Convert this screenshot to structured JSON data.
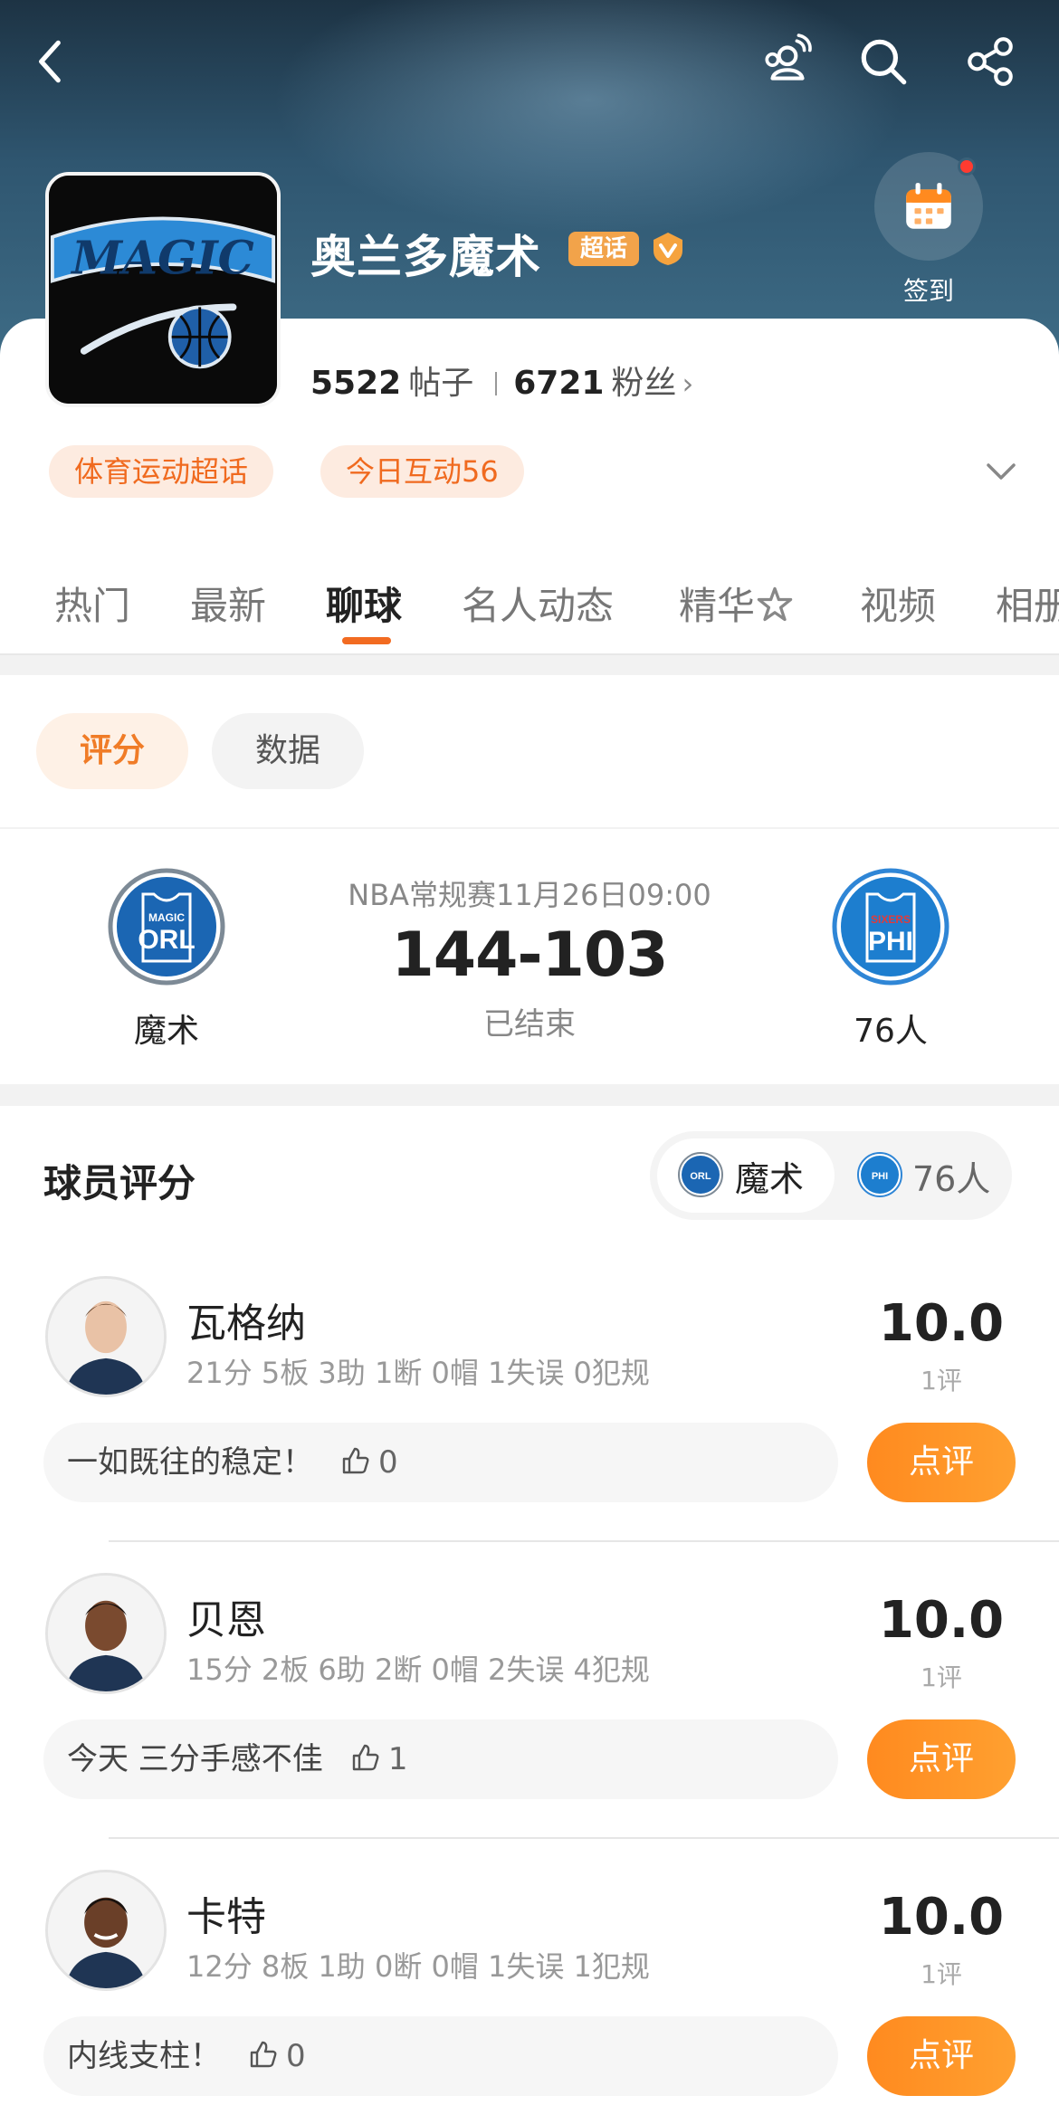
{
  "header": {
    "team_name": "奥兰多魔术",
    "super_badge": "超话",
    "signin_label": "签到"
  },
  "stats": {
    "posts_count": "5522",
    "posts_label": "帖子",
    "fans_count": "6721",
    "fans_label": "粉丝"
  },
  "tags": [
    "体育运动超话",
    "今日互动56"
  ],
  "tabs": [
    "热门",
    "最新",
    "聊球",
    "名人动态",
    "精华",
    "视频",
    "相册"
  ],
  "active_tab": "聊球",
  "segment": {
    "rating": "评分",
    "data": "数据"
  },
  "match": {
    "meta": "NBA常规赛11月26日09:00",
    "score": "144-103",
    "status": "已结束",
    "home_team": "魔术",
    "away_team": "76人",
    "home_logo_text": "MAGIC",
    "home_abbr": "ORL",
    "away_logo_text": "SIXERS",
    "away_abbr": "PHI"
  },
  "ratings": {
    "title": "球员评分",
    "switch_home": "魔术",
    "switch_away": "76人",
    "review_label": "点评",
    "players": [
      {
        "name": "瓦格纳",
        "stats": "21分 5板 3助 1断 0帽 1失误 0犯规",
        "score": "10.0",
        "count": "1评",
        "comment": "一如既往的稳定！",
        "likes": "0"
      },
      {
        "name": "贝恩",
        "stats": "15分 2板 6助 2断 0帽 2失误 4犯规",
        "score": "10.0",
        "count": "1评",
        "comment": "今天 三分手感不佳",
        "likes": "1"
      },
      {
        "name": "卡特",
        "stats": "12分 8板 1助 0断 0帽 1失误 1犯规",
        "score": "10.0",
        "count": "1评",
        "comment": "内线支柱！",
        "likes": "0"
      }
    ]
  },
  "colors": {
    "accent": "#f26b21",
    "button": "#ff8a1f",
    "magic_blue": "#1b66b3",
    "sixers_blue": "#1d7ecf"
  }
}
